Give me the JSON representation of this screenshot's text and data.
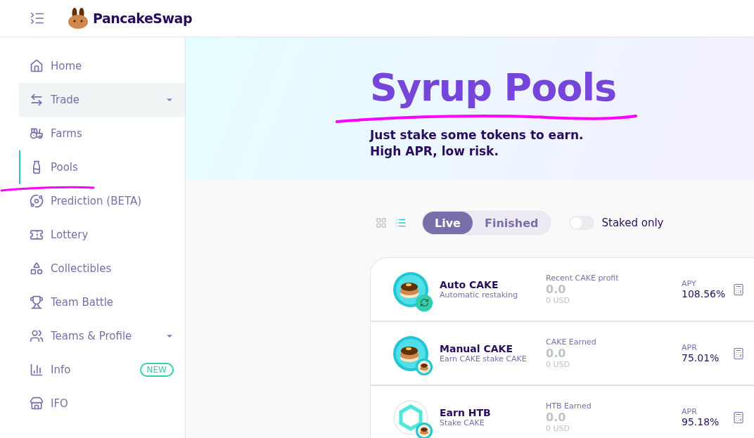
{
  "header": {
    "logo": "PancakeSwap"
  },
  "sidebar": {
    "items": [
      {
        "label": "Home",
        "selected": false,
        "highlighted": false,
        "dropdown": false
      },
      {
        "label": "Trade",
        "selected": false,
        "highlighted": true,
        "dropdown": true
      },
      {
        "label": "Farms",
        "selected": false,
        "highlighted": false,
        "dropdown": false
      },
      {
        "label": "Pools",
        "selected": true,
        "highlighted": false,
        "dropdown": false
      },
      {
        "label": "Prediction (BETA)",
        "selected": false,
        "highlighted": false,
        "dropdown": false
      },
      {
        "label": "Lottery",
        "selected": false,
        "highlighted": false,
        "dropdown": false
      },
      {
        "label": "Collectibles",
        "selected": false,
        "highlighted": false,
        "dropdown": false
      },
      {
        "label": "Team Battle",
        "selected": false,
        "highlighted": false,
        "dropdown": false
      },
      {
        "label": "Teams & Profile",
        "selected": false,
        "highlighted": false,
        "dropdown": true
      },
      {
        "label": "Info",
        "selected": false,
        "highlighted": false,
        "dropdown": false,
        "badge": "NEW"
      },
      {
        "label": "IFO",
        "selected": false,
        "highlighted": false,
        "dropdown": false
      }
    ]
  },
  "hero": {
    "title": "Syrup Pools",
    "subtitle_lines": [
      "Just stake some tokens to earn.",
      "High APR, low risk."
    ]
  },
  "view_toggles": [
    {
      "kind": "grid",
      "selected": false
    },
    {
      "kind": "list",
      "selected": true
    }
  ],
  "tabs": [
    {
      "label": "Live",
      "selected": true
    },
    {
      "label": "Finished",
      "selected": false
    }
  ],
  "staked_only": {
    "label": "Staked only",
    "on": false
  },
  "pools": [
    {
      "kind": "auto",
      "name": "Auto CAKE",
      "subtitle": "Automatic restaking",
      "earned_label": "Recent CAKE profit",
      "earned": "0.0",
      "earned_usd": "0 USD",
      "rate_label": "APY",
      "rate": "108.56%"
    },
    {
      "kind": "manual",
      "name": "Manual CAKE",
      "subtitle": "Earn CAKE stake CAKE",
      "earned_label": "CAKE Earned",
      "earned": "0.0",
      "earned_usd": "0 USD",
      "rate_label": "APR",
      "rate": "75.01%"
    },
    {
      "kind": "partner",
      "name": "Earn HTB",
      "subtitle": "Stake CAKE",
      "earned_label": "HTB Earned",
      "earned": "0.0",
      "earned_usd": "0 USD",
      "rate_label": "APR",
      "rate": "95.18%"
    }
  ]
}
